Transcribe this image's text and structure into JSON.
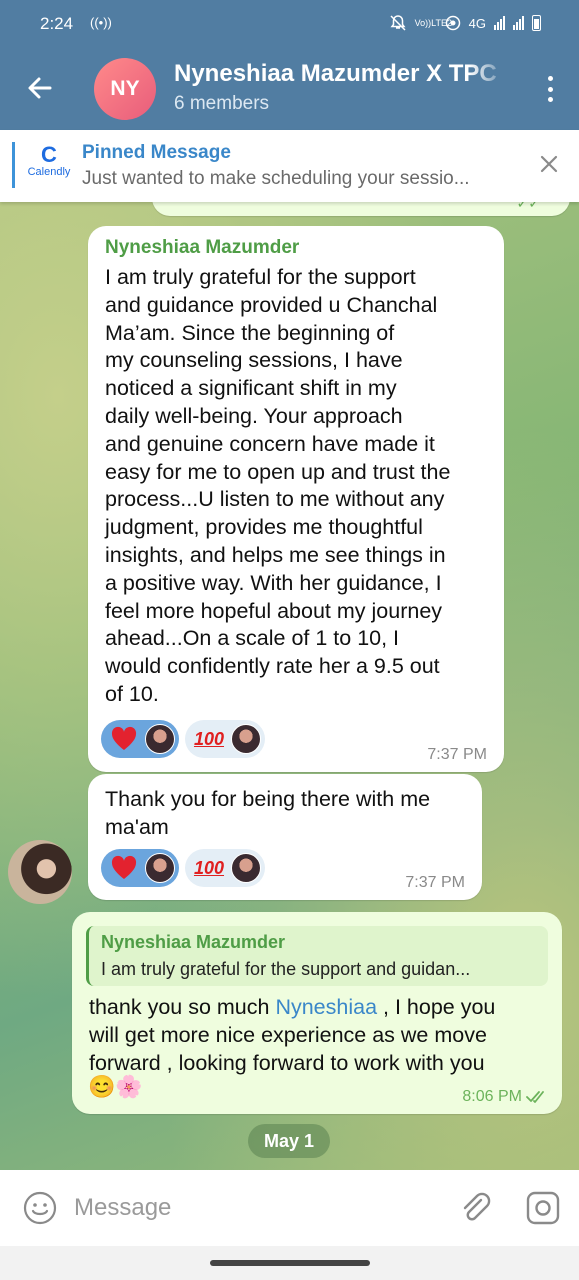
{
  "status_bar": {
    "time": "2:24",
    "hotspot_icon": "((•))",
    "volte": "Vo))LTE2",
    "network": "4G",
    "icons": [
      "mute-icon",
      "hotspot-icon",
      "signal-icon",
      "battery-icon"
    ]
  },
  "header": {
    "avatar_initials": "NY",
    "title": "Nyneshiaa Mazumder X TPC",
    "subtitle": "6 members",
    "colors": {
      "bar": "#517da2",
      "avatar": "#e85d7b"
    }
  },
  "pinned": {
    "title": "Pinned Message",
    "logo_text": "Calendly",
    "text": "Just wanted to make scheduling your sessio..."
  },
  "messages": [
    {
      "sender": "Nyneshiaa Mazumder",
      "text_lines": [
        "I am truly grateful for the support",
        "and guidance provided u Chanchal",
        "Ma’am. Since the beginning of",
        "my counseling sessions, I have",
        "noticed a significant shift in my",
        "daily well-being. Your approach",
        "and genuine concern have made it",
        "easy for me to open up and trust the",
        "process...U listen to me without any",
        "judgment, provides me thoughtful",
        "insights, and helps me see things in",
        "a positive way. With her guidance, I",
        "feel more hopeful about my journey",
        "ahead...On a scale of 1 to 10, I",
        "would confidently rate her a 9.5 out",
        "of 10."
      ],
      "time": "7:37 PM",
      "reactions": [
        "heart",
        "hundred"
      ]
    },
    {
      "text_lines": [
        "Thank you for being there with me",
        "ma'am"
      ],
      "time": "7:37 PM",
      "reactions": [
        "heart",
        "hundred"
      ]
    },
    {
      "reply_to": {
        "name": "Nyneshiaa Mazumder",
        "text": "I am truly grateful for the support and guidan..."
      },
      "text_before": "thank you so much ",
      "mention": "Nyneshiaa",
      "text_after": " , I hope you",
      "text_line2": "will get more nice experience as we move",
      "text_line3": "forward , looking forward to work with you",
      "emoji": "😊🌸",
      "time": "8:06 PM"
    }
  ],
  "reaction_hundred": "100",
  "date_separator": "May 1",
  "input": {
    "placeholder": "Message"
  }
}
